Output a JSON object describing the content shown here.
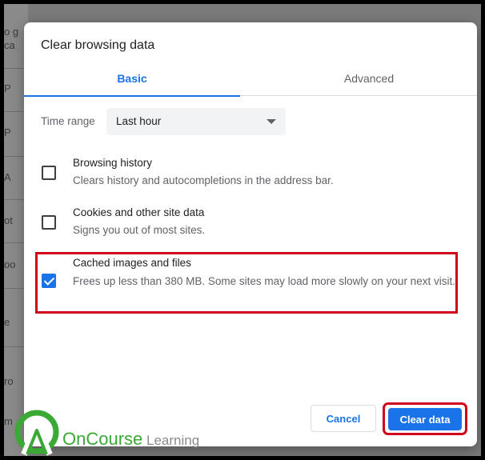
{
  "background": {
    "fragments": [
      "o g",
      "ca",
      "P",
      "P",
      "A",
      "ot",
      "oo",
      "e",
      "ro",
      "m"
    ]
  },
  "dialog": {
    "title": "Clear browsing data",
    "tabs": {
      "basic": "Basic",
      "advanced": "Advanced"
    },
    "time_range": {
      "label": "Time range",
      "value": "Last hour"
    },
    "options": [
      {
        "title": "Browsing history",
        "desc": "Clears history and autocompletions in the address bar.",
        "checked": false
      },
      {
        "title": "Cookies and other site data",
        "desc": "Signs you out of most sites.",
        "checked": false
      },
      {
        "title": "Cached images and files",
        "desc": "Frees up less than 380 MB. Some sites may load more slowly on your next visit.",
        "checked": true
      }
    ],
    "buttons": {
      "cancel": "Cancel",
      "clear": "Clear data"
    }
  },
  "logo": {
    "brand_part1": "OnCourse",
    "brand_part2": " Learning"
  },
  "colors": {
    "accent": "#1a73e8",
    "highlight": "#d0021b",
    "logo_green": "#3aaa35"
  }
}
